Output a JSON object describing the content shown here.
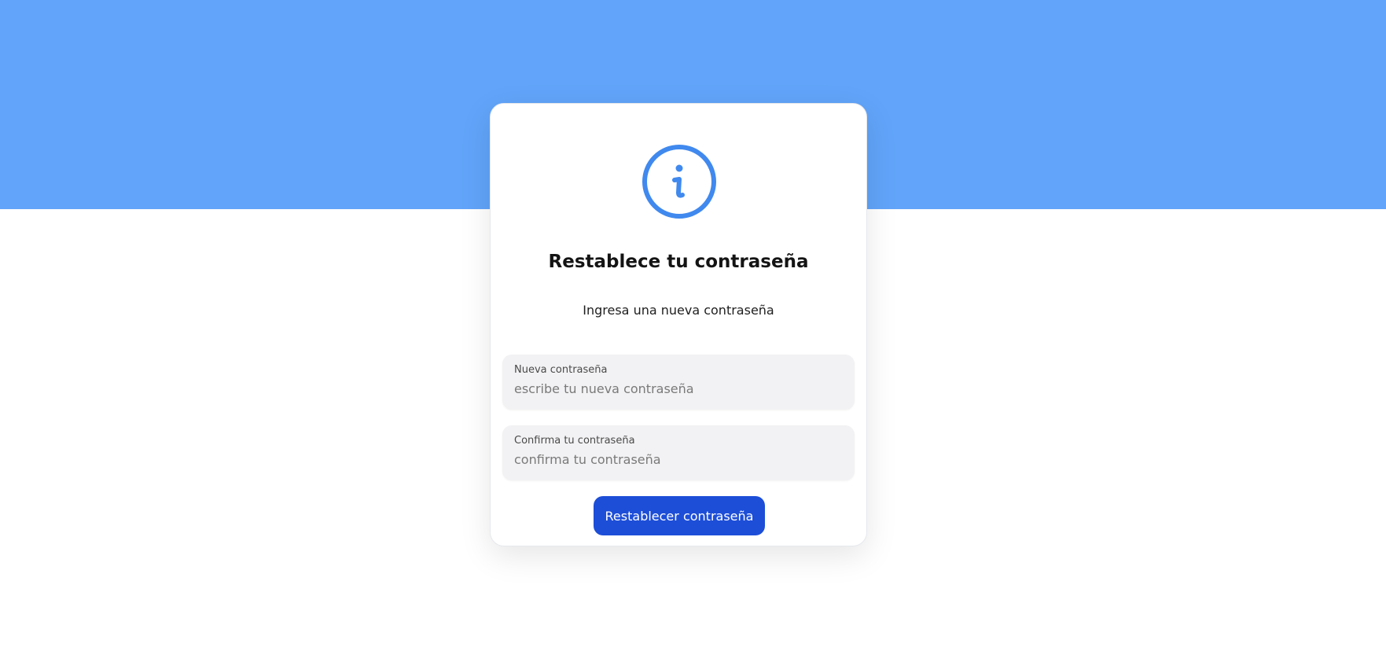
{
  "colors": {
    "header_band": "#61a4f9",
    "icon_accent": "#4089ee",
    "button_bg": "#1d4ed8",
    "field_bg": "#f2f2f4"
  },
  "card": {
    "icon": "info-circle-icon",
    "title": "Restablece tu contraseña",
    "subtitle": "Ingresa una nueva contraseña"
  },
  "form": {
    "new_password": {
      "label": "Nueva contraseña",
      "value": "",
      "placeholder": "escribe tu nueva contraseña"
    },
    "confirm_password": {
      "label": "Confirma tu contraseña",
      "value": "",
      "placeholder": "confirma tu contraseña"
    },
    "submit_label": "Restablecer contraseña"
  }
}
